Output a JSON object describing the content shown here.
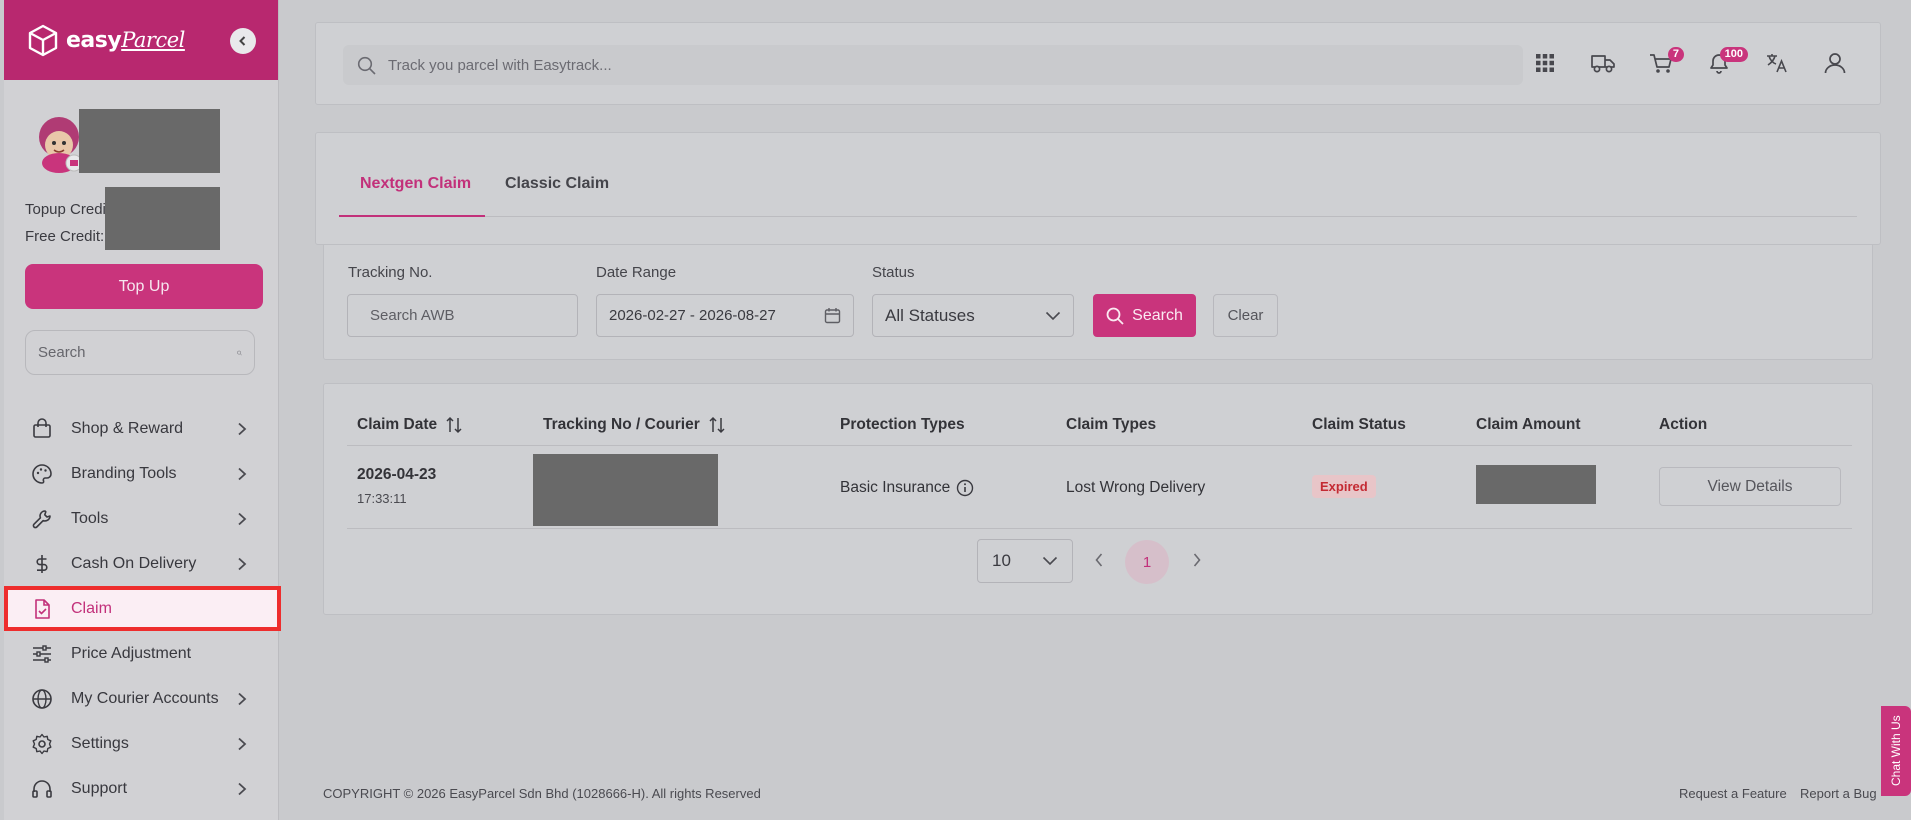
{
  "brand": {
    "name_bold": "easy",
    "name_script": "Parcel"
  },
  "sidebar": {
    "topup_label": "Topup Credit:",
    "free_label": "Free Credit:",
    "topup_button": "Top Up",
    "search_placeholder": "Search",
    "items": [
      {
        "label": "Shop & Reward",
        "icon": "bag-icon",
        "chevron": true
      },
      {
        "label": "Branding Tools",
        "icon": "palette-icon",
        "chevron": true
      },
      {
        "label": "Tools",
        "icon": "wrench-icon",
        "chevron": true
      },
      {
        "label": "Cash On Delivery",
        "icon": "dollar-icon",
        "chevron": true
      },
      {
        "label": "Claim",
        "icon": "claim-doc-icon",
        "chevron": false,
        "active": true
      },
      {
        "label": "Price Adjustment",
        "icon": "sliders-icon",
        "chevron": false
      },
      {
        "label": "My Courier Accounts",
        "icon": "globe-icon",
        "chevron": true
      },
      {
        "label": "Settings",
        "icon": "gear-icon",
        "chevron": true
      },
      {
        "label": "Support",
        "icon": "headset-icon",
        "chevron": true
      }
    ]
  },
  "topbar": {
    "search_placeholder": "Track you parcel with Easytrack...",
    "cart_count": "7",
    "notif_count": "100"
  },
  "tabs": {
    "nextgen": "Nextgen Claim",
    "classic": "Classic Claim"
  },
  "filters": {
    "tracking_label": "Tracking No.",
    "tracking_placeholder": "Search AWB",
    "date_label": "Date Range",
    "date_value": "2026-02-27 - 2026-08-27",
    "status_label": "Status",
    "status_value": "All Statuses",
    "search_button": "Search",
    "clear_button": "Clear"
  },
  "table": {
    "headers": {
      "claim_date": "Claim Date",
      "tracking": "Tracking No / Courier",
      "protection": "Protection Types",
      "claim_types": "Claim Types",
      "claim_status": "Claim Status",
      "claim_amount": "Claim Amount",
      "action": "Action"
    },
    "rows": [
      {
        "date": "2026-04-23",
        "time": "17:33:11",
        "protection": "Basic Insurance",
        "claim_type": "Lost Wrong Delivery",
        "status": "Expired",
        "action": "View Details"
      }
    ],
    "page_size": "10",
    "current_page": "1"
  },
  "footer": {
    "copyright": "COPYRIGHT © 2026 EasyParcel Sdn Bhd (1028666-H). All rights Reserved",
    "request_feature": "Request a Feature",
    "report_bug": "Report a Bug"
  },
  "chat": {
    "label": "Chat With Us"
  },
  "colors": {
    "accent": "#c9347c",
    "brand_bg": "#b8286f",
    "highlight": "#ee2d2d"
  }
}
